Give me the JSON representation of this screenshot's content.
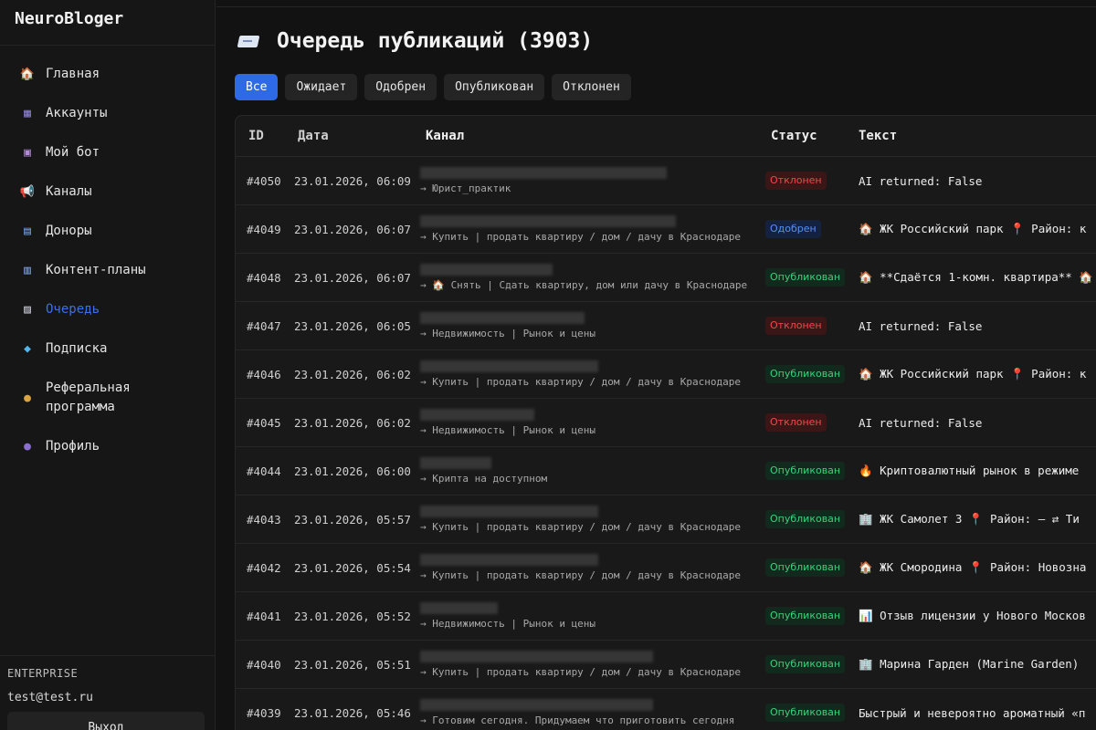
{
  "sidebar": {
    "brand": "NeuroBloger",
    "items": [
      {
        "icon": "home-icon",
        "glyph": "🏠",
        "label": "Главная"
      },
      {
        "icon": "accounts-icon",
        "glyph": "▦",
        "label": "Аккаунты"
      },
      {
        "icon": "bot-icon",
        "glyph": "▣",
        "label": "Мой бот"
      },
      {
        "icon": "megaphone-icon",
        "glyph": "📢",
        "label": "Каналы"
      },
      {
        "icon": "donors-icon",
        "glyph": "▤",
        "label": "Доноры"
      },
      {
        "icon": "calendar-icon",
        "glyph": "▥",
        "label": "Контент-планы"
      },
      {
        "icon": "queue-icon",
        "glyph": "▨",
        "label": "Очередь"
      },
      {
        "icon": "diamond-icon",
        "glyph": "◆",
        "label": "Подписка"
      },
      {
        "icon": "money-bag-icon",
        "glyph": "●",
        "label": "Реферальная\nпрограмма"
      },
      {
        "icon": "user-icon",
        "glyph": "●",
        "label": "Профиль"
      }
    ],
    "plan": "ENTERPRISE",
    "email": "test@test.ru",
    "logout": "Выход"
  },
  "main": {
    "title": "Очередь публикаций (3903)",
    "filters": [
      "Все",
      "Ожидает",
      "Одобрен",
      "Опубликован",
      "Отклонен"
    ],
    "columns": [
      "ID",
      "Дата",
      "Канал",
      "Статус",
      "Текст"
    ],
    "rows": [
      {
        "id": "#4050",
        "date": "23.01.2026, 06:09",
        "channel_sub": "→ Юрист_практик",
        "status": "Отклонен",
        "status_kind": "rejected",
        "text": "AI returned: False"
      },
      {
        "id": "#4049",
        "date": "23.01.2026, 06:07",
        "channel_sub": "→ Купить | продать квартиру / дом / дачу в Краснодаре",
        "status": "Одобрен",
        "status_kind": "approved",
        "text": "🏠 ЖК Российский парк 📍 Район: к"
      },
      {
        "id": "#4048",
        "date": "23.01.2026, 06:07",
        "channel_sub": "→ 🏠 Снять | Сдать квартиру, дом или дачу в Краснодаре",
        "status": "Опубликован",
        "status_kind": "published",
        "text": "🏠 **Сдаётся 1-комн. квартира** 🏠"
      },
      {
        "id": "#4047",
        "date": "23.01.2026, 06:05",
        "channel_sub": "→ Недвижимость | Рынок и цены",
        "status": "Отклонен",
        "status_kind": "rejected",
        "text": "AI returned: False"
      },
      {
        "id": "#4046",
        "date": "23.01.2026, 06:02",
        "channel_sub": "→ Купить | продать квартиру / дом / дачу в Краснодаре",
        "status": "Опубликован",
        "status_kind": "published",
        "text": "🏠 ЖК Российский парк 📍 Район: к"
      },
      {
        "id": "#4045",
        "date": "23.01.2026, 06:02",
        "channel_sub": "→ Недвижимость | Рынок и цены",
        "status": "Отклонен",
        "status_kind": "rejected",
        "text": "AI returned: False"
      },
      {
        "id": "#4044",
        "date": "23.01.2026, 06:00",
        "channel_sub": "→ Крипта на доступном",
        "status": "Опубликован",
        "status_kind": "published",
        "text": "🔥 Криптовалютный рынок в режиме"
      },
      {
        "id": "#4043",
        "date": "23.01.2026, 05:57",
        "channel_sub": "→ Купить | продать квартиру / дом / дачу в Краснодаре",
        "status": "Опубликован",
        "status_kind": "published",
        "text": "🏢 ЖК Самолет 3 📍 Район: – ⇄ Ти"
      },
      {
        "id": "#4042",
        "date": "23.01.2026, 05:54",
        "channel_sub": "→ Купить | продать квартиру / дом / дачу в Краснодаре",
        "status": "Опубликован",
        "status_kind": "published",
        "text": "🏠 ЖК Смородина 📍 Район: Новозна"
      },
      {
        "id": "#4041",
        "date": "23.01.2026, 05:52",
        "channel_sub": "→ Недвижимость | Рынок и цены",
        "status": "Опубликован",
        "status_kind": "published",
        "text": "📊 Отзыв лицензии у Нового Москов"
      },
      {
        "id": "#4040",
        "date": "23.01.2026, 05:51",
        "channel_sub": "→ Купить | продать квартиру / дом / дачу в Краснодаре",
        "status": "Опубликован",
        "status_kind": "published",
        "text": "🏢 Марина Гарден (Marine Garden)"
      },
      {
        "id": "#4039",
        "date": "23.01.2026, 05:46",
        "channel_sub": "→ Готовим сегодня. Придумаем что приготовить сегодня",
        "status": "Опубликован",
        "status_kind": "published",
        "text": "Быстрый и невероятно ароматный «п"
      }
    ]
  }
}
